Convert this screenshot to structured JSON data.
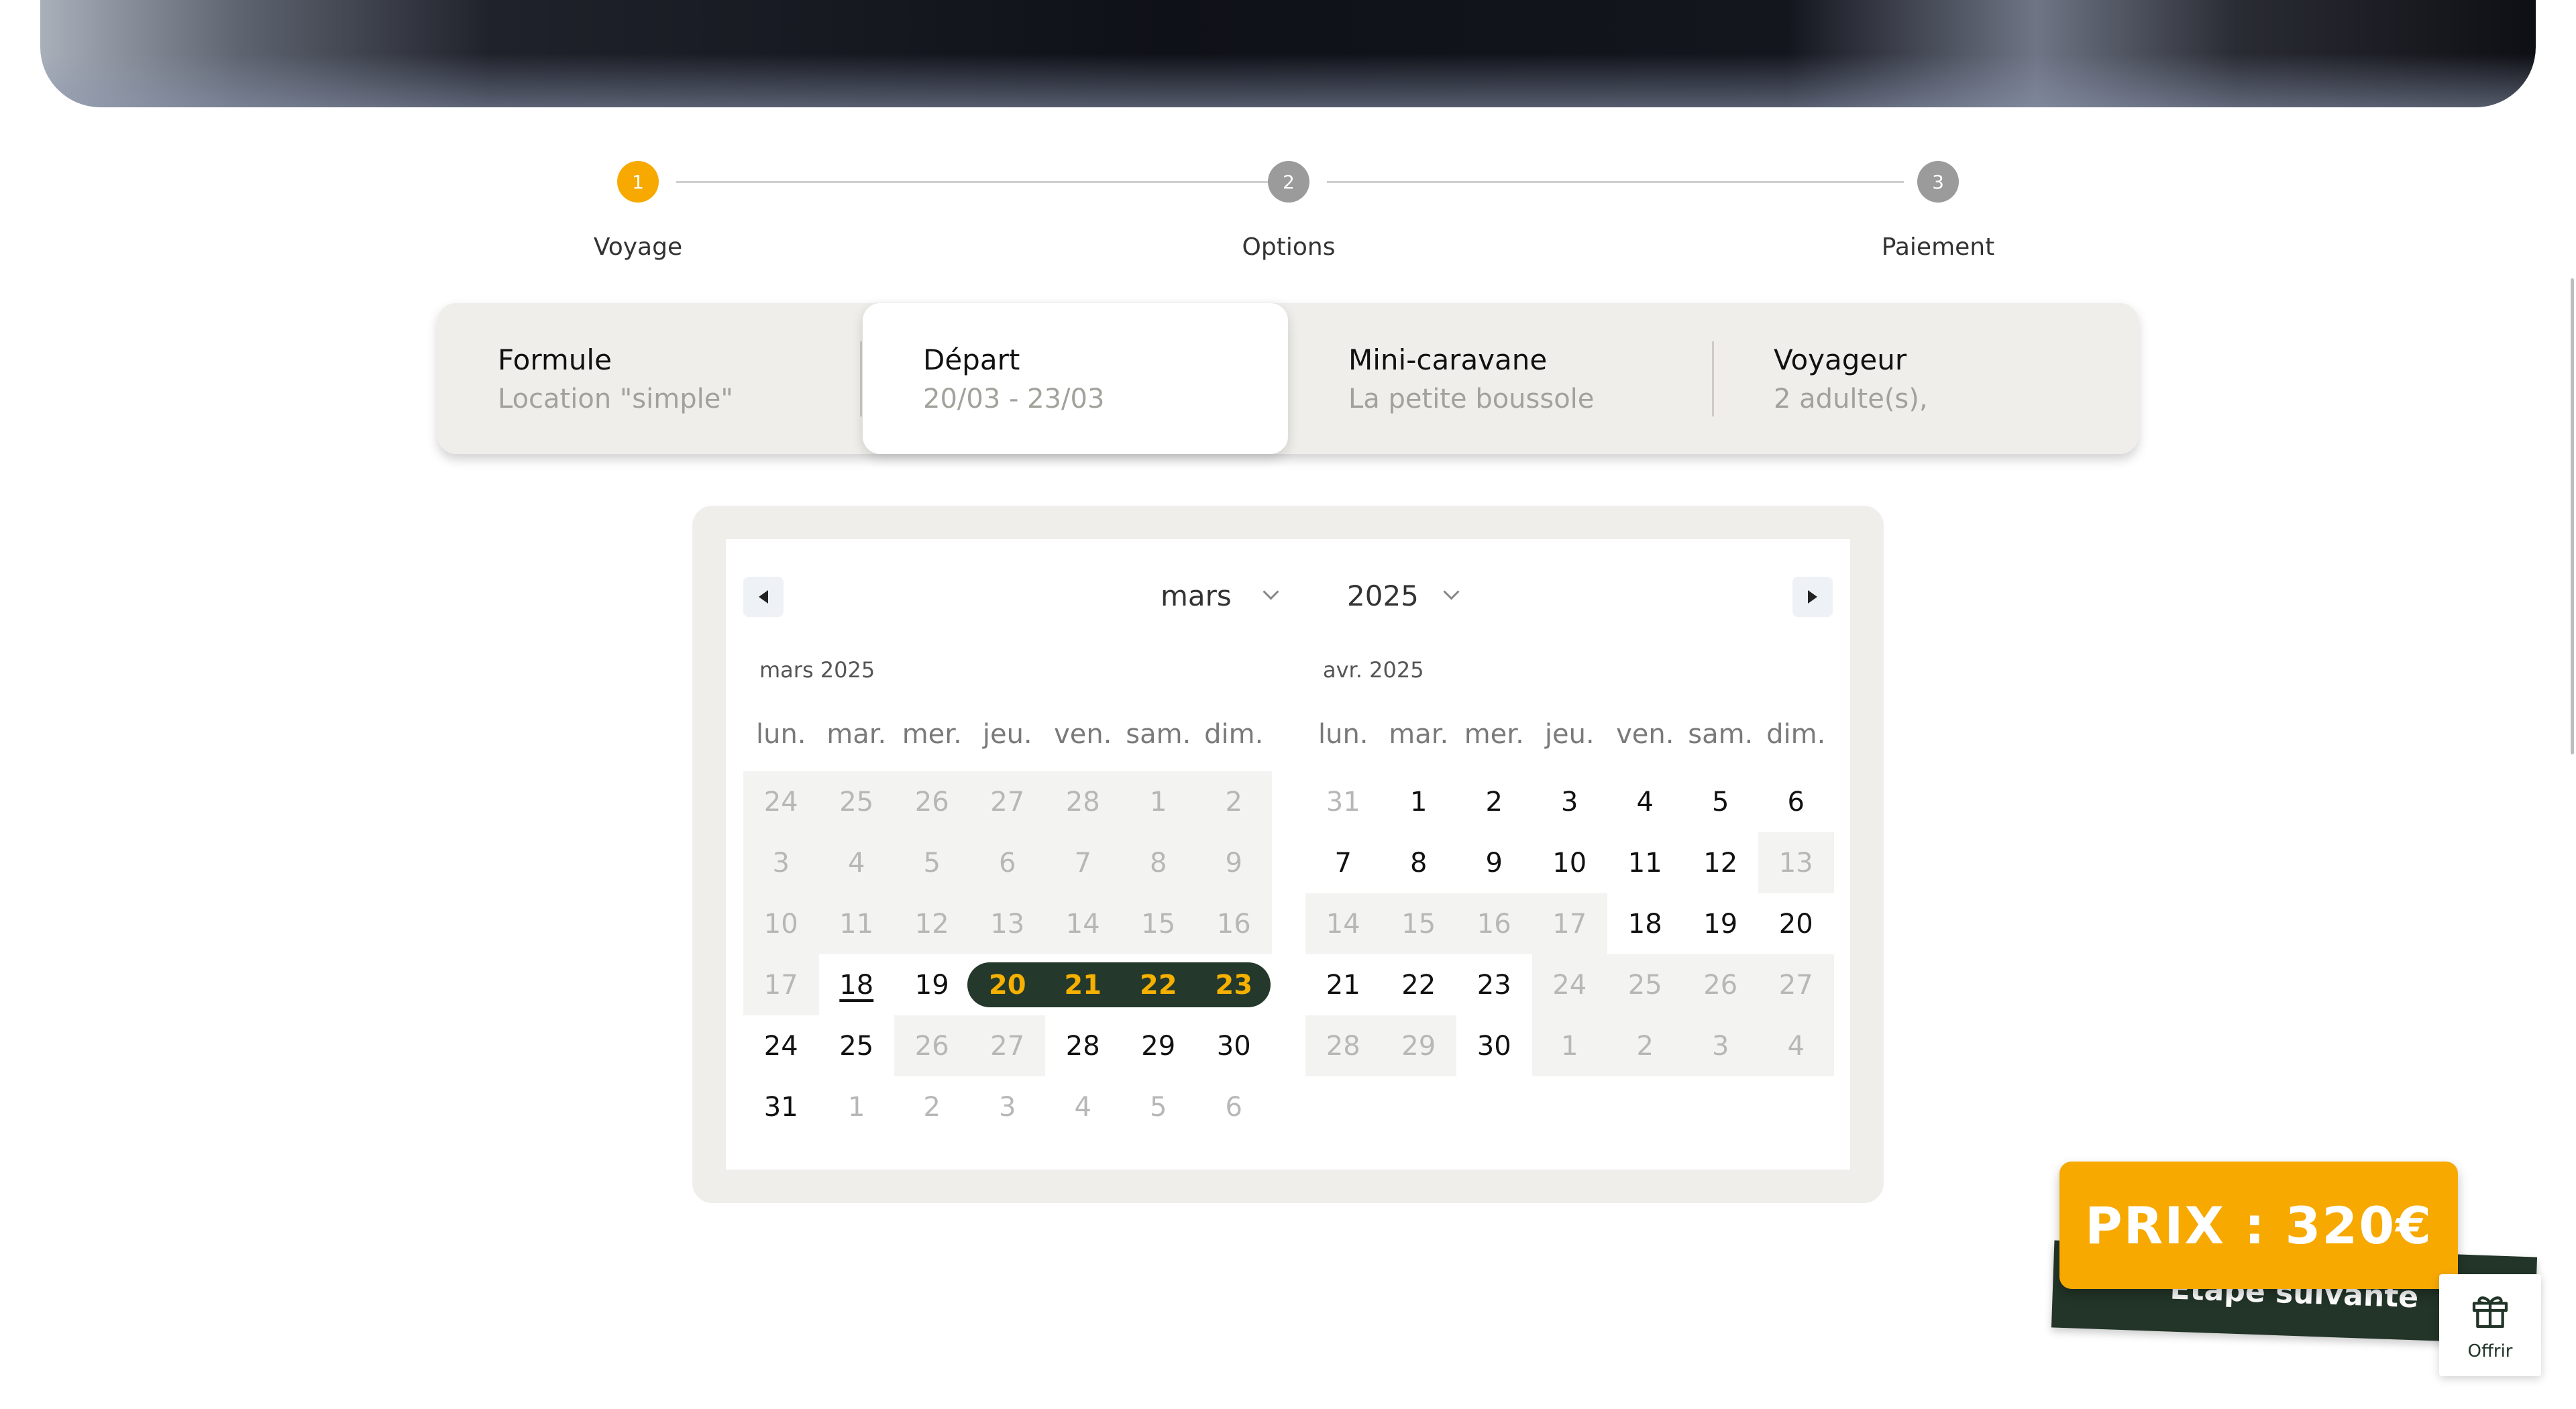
{
  "stepper": {
    "steps": [
      {
        "number": "1",
        "label": "Voyage",
        "active": true
      },
      {
        "number": "2",
        "label": "Options",
        "active": false
      },
      {
        "number": "3",
        "label": "Paiement",
        "active": false
      }
    ],
    "active_color": "#f7a900",
    "inactive_color": "#9b9b9b"
  },
  "tabs": [
    {
      "title": "Formule",
      "subtitle": "Location \"simple\""
    },
    {
      "title": "Départ",
      "subtitle": "20/03 - 23/03"
    },
    {
      "title": "Mini-caravane",
      "subtitle": "La petite boussole"
    },
    {
      "title": "Voyageur",
      "subtitle": "2 adulte(s),"
    }
  ],
  "calendar": {
    "month_select": "mars",
    "year_select": "2025",
    "weekdays": [
      "lun.",
      "mar.",
      "mer.",
      "jeu.",
      "ven.",
      "sam.",
      "dim."
    ],
    "months": [
      {
        "caption": "mars 2025",
        "weeks": [
          [
            "24",
            "25",
            "26",
            "27",
            "28",
            "1",
            "2"
          ],
          [
            "3",
            "4",
            "5",
            "6",
            "7",
            "8",
            "9"
          ],
          [
            "10",
            "11",
            "12",
            "13",
            "14",
            "15",
            "16"
          ],
          [
            "17",
            "18",
            "19",
            "20",
            "21",
            "22",
            "23"
          ],
          [
            "24",
            "25",
            "26",
            "27",
            "28",
            "29",
            "30"
          ],
          [
            "31",
            "1",
            "2",
            "3",
            "4",
            "5",
            "6"
          ]
        ]
      },
      {
        "caption": "avr. 2025",
        "weeks": [
          [
            "31",
            "1",
            "2",
            "3",
            "4",
            "5",
            "6"
          ],
          [
            "7",
            "8",
            "9",
            "10",
            "11",
            "12",
            "13"
          ],
          [
            "14",
            "15",
            "16",
            "17",
            "18",
            "19",
            "20"
          ],
          [
            "21",
            "22",
            "23",
            "24",
            "25",
            "26",
            "27"
          ],
          [
            "28",
            "29",
            "30",
            "1",
            "2",
            "3",
            "4"
          ]
        ]
      }
    ],
    "today": "18",
    "selected_range": [
      "20",
      "21",
      "22",
      "23"
    ],
    "range_bg": "#24392b",
    "range_text": "#f5b000"
  },
  "price": {
    "label": "PRIX : 320€"
  },
  "next_step": {
    "label": "Étape suivante"
  },
  "gift": {
    "label": "Offrir",
    "icon": "gift-icon"
  }
}
